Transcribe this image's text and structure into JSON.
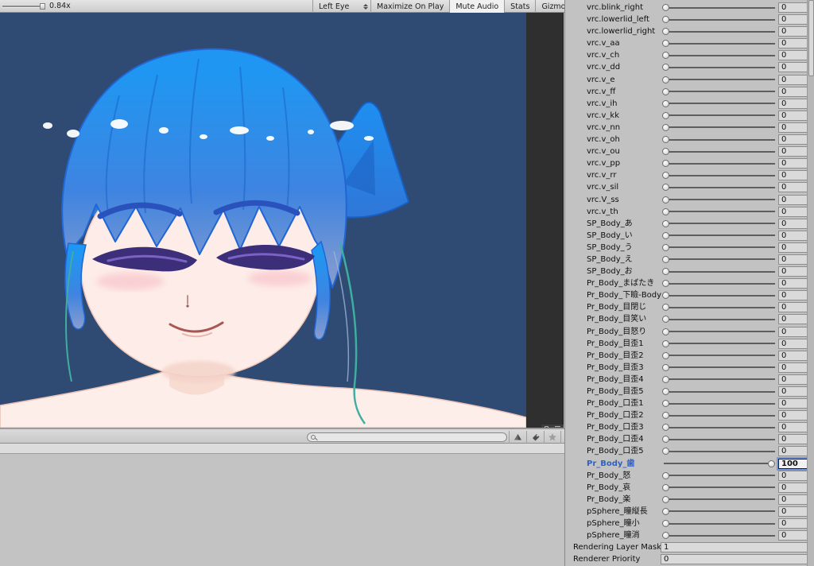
{
  "game_toolbar": {
    "scale_value": "0.84x",
    "display_select": "Left Eye",
    "maximize_on_play": "Maximize On Play",
    "mute_audio": "Mute Audio",
    "stats": "Stats",
    "gizmos": "Gizmos"
  },
  "project_panel": {
    "search_value": ""
  },
  "inspector": {
    "selected_color": "#2d61c6",
    "blendshapes": [
      {
        "name": "vrc.blink_right",
        "value": "0"
      },
      {
        "name": "vrc.lowerlid_left",
        "value": "0"
      },
      {
        "name": "vrc.lowerlid_right",
        "value": "0"
      },
      {
        "name": "vrc.v_aa",
        "value": "0"
      },
      {
        "name": "vrc.v_ch",
        "value": "0"
      },
      {
        "name": "vrc.v_dd",
        "value": "0"
      },
      {
        "name": "vrc.v_e",
        "value": "0"
      },
      {
        "name": "vrc.v_ff",
        "value": "0"
      },
      {
        "name": "vrc.v_ih",
        "value": "0"
      },
      {
        "name": "vrc.v_kk",
        "value": "0"
      },
      {
        "name": "vrc.v_nn",
        "value": "0"
      },
      {
        "name": "vrc.v_oh",
        "value": "0"
      },
      {
        "name": "vrc.v_ou",
        "value": "0"
      },
      {
        "name": "vrc.v_pp",
        "value": "0"
      },
      {
        "name": "vrc.v_rr",
        "value": "0"
      },
      {
        "name": "vrc.v_sil",
        "value": "0"
      },
      {
        "name": "vrc.V_ss",
        "value": "0"
      },
      {
        "name": "vrc.v_th",
        "value": "0"
      },
      {
        "name": "SP_Body_あ",
        "value": "0"
      },
      {
        "name": "SP_Body_い",
        "value": "0"
      },
      {
        "name": "SP_Body_う",
        "value": "0"
      },
      {
        "name": "SP_Body_え",
        "value": "0"
      },
      {
        "name": "SP_Body_お",
        "value": "0"
      },
      {
        "name": "Pr_Body_まばたき",
        "value": "0"
      },
      {
        "name": "Pr_Body_下瞼-Body",
        "value": "0"
      },
      {
        "name": "Pr_Body_目閉じ",
        "value": "0"
      },
      {
        "name": "Pr_Body_目笑い",
        "value": "0"
      },
      {
        "name": "Pr_Body_目怒り",
        "value": "0"
      },
      {
        "name": "Pr_Body_目歪1",
        "value": "0"
      },
      {
        "name": "Pr_Body_目歪2",
        "value": "0"
      },
      {
        "name": "Pr_Body_目歪3",
        "value": "0"
      },
      {
        "name": "Pr_Body_目歪4",
        "value": "0"
      },
      {
        "name": "Pr_Body_目歪5",
        "value": "0"
      },
      {
        "name": "Pr_Body_口歪1",
        "value": "0"
      },
      {
        "name": "Pr_Body_口歪2",
        "value": "0"
      },
      {
        "name": "Pr_Body_口歪3",
        "value": "0"
      },
      {
        "name": "Pr_Body_口歪4",
        "value": "0"
      },
      {
        "name": "Pr_Body_口歪5",
        "value": "0"
      },
      {
        "name": "Pr_Body_歯",
        "value": "100",
        "selected": true
      },
      {
        "name": "Pr_Body_怒",
        "value": "0"
      },
      {
        "name": "Pr_Body_哀",
        "value": "0"
      },
      {
        "name": "Pr_Body_楽",
        "value": "0"
      },
      {
        "name": "pSphere_瞳縦長",
        "value": "0"
      },
      {
        "name": "pSphere_瞳小",
        "value": "0"
      },
      {
        "name": "pSphere_瞳消",
        "value": "0"
      }
    ],
    "properties": [
      {
        "label": "Rendering Layer Mask",
        "value": "1"
      },
      {
        "label": "Renderer Priority",
        "value": "0"
      }
    ]
  },
  "colors": {
    "game_bg": "#2f4a73",
    "letterbox": "#302f30",
    "panel_bg": "#c2c2c2"
  }
}
